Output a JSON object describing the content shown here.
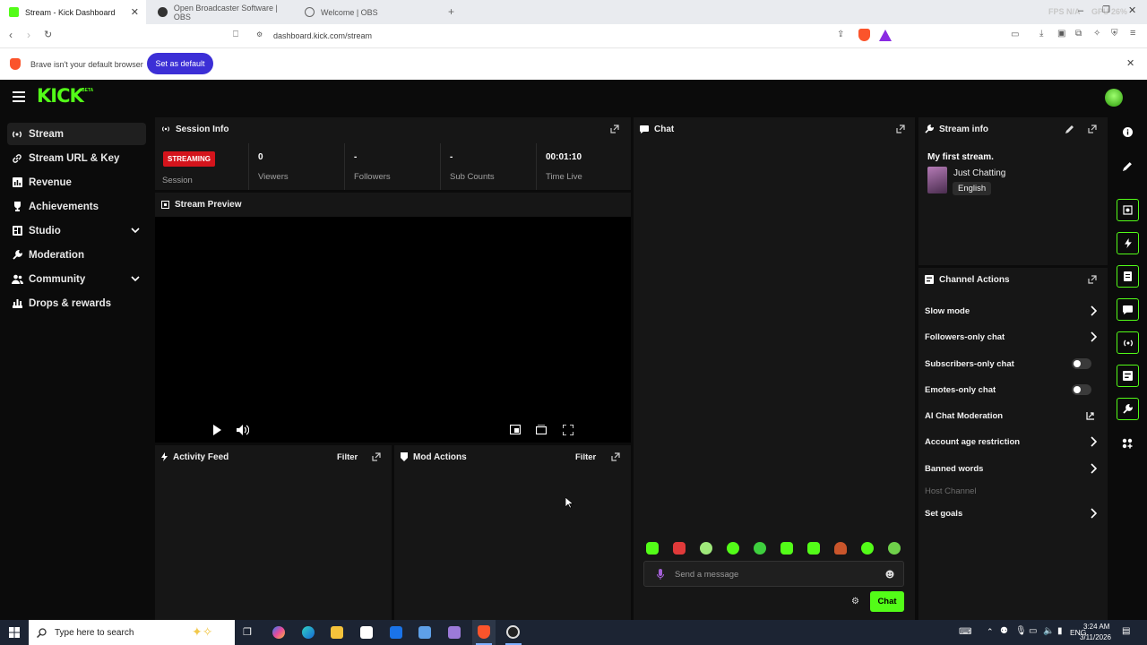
{
  "browser": {
    "tabs": [
      {
        "title": "Stream - Kick Dashboard",
        "active": true
      },
      {
        "title": "Open Broadcaster Software | OBS",
        "active": false
      },
      {
        "title": "Welcome | OBS",
        "active": false
      }
    ],
    "url": "dashboard.kick.com/stream",
    "overlay_fps": "FPS N/A",
    "overlay_gpu": "GPU 26%",
    "infobar_text": "Brave isn't your default browser",
    "infobar_button": "Set as default"
  },
  "app": {
    "logo": "KICK",
    "logo_badge": "BETA",
    "accent_color": "#53fc18",
    "sidebar": [
      {
        "label": "Stream",
        "icon": "broadcast-icon",
        "active": true,
        "expandable": false
      },
      {
        "label": "Stream URL & Key",
        "icon": "link-icon",
        "active": false,
        "expandable": false
      },
      {
        "label": "Revenue",
        "icon": "chart-icon",
        "active": false,
        "expandable": false
      },
      {
        "label": "Achievements",
        "icon": "trophy-icon",
        "active": false,
        "expandable": false
      },
      {
        "label": "Studio",
        "icon": "studio-icon",
        "active": false,
        "expandable": true
      },
      {
        "label": "Moderation",
        "icon": "wrench-icon",
        "active": false,
        "expandable": false
      },
      {
        "label": "Community",
        "icon": "people-icon",
        "active": false,
        "expandable": true
      },
      {
        "label": "Drops & rewards",
        "icon": "gift-icon",
        "active": false,
        "expandable": false
      }
    ],
    "session": {
      "title": "Session Info",
      "status_badge": "STREAMING",
      "status_label": "Session",
      "stats": [
        {
          "value": "0",
          "label": "Viewers"
        },
        {
          "value": "-",
          "label": "Followers"
        },
        {
          "value": "-",
          "label": "Sub Counts"
        },
        {
          "value": "00:01:10",
          "label": "Time Live"
        }
      ]
    },
    "preview": {
      "title": "Stream Preview"
    },
    "activity": {
      "title": "Activity Feed",
      "filter": "Filter"
    },
    "mod_actions": {
      "title": "Mod Actions",
      "filter": "Filter"
    },
    "chat": {
      "title": "Chat",
      "placeholder": "Send a message",
      "send_button": "Chat"
    },
    "stream_info": {
      "title": "Stream info",
      "stream_title": "My first stream.",
      "category": "Just Chatting",
      "language": "English"
    },
    "channel_actions": {
      "title": "Channel Actions",
      "items": [
        {
          "label": "Slow mode",
          "control": "chevron"
        },
        {
          "label": "Followers-only chat",
          "control": "chevron"
        },
        {
          "label": "Subscribers-only chat",
          "control": "toggle",
          "on": false
        },
        {
          "label": "Emotes-only chat",
          "control": "toggle",
          "on": false
        },
        {
          "label": "AI Chat Moderation",
          "control": "external"
        },
        {
          "label": "Account age restriction",
          "control": "chevron"
        },
        {
          "label": "Banned words",
          "control": "chevron"
        },
        {
          "label": "Host Channel",
          "control": "none",
          "disabled": true
        },
        {
          "label": "Set goals",
          "control": "chevron"
        }
      ]
    }
  },
  "taskbar": {
    "search_placeholder": "Type here to search",
    "language": "ENG",
    "time": "3:24 AM",
    "date": "3/11/2026"
  }
}
